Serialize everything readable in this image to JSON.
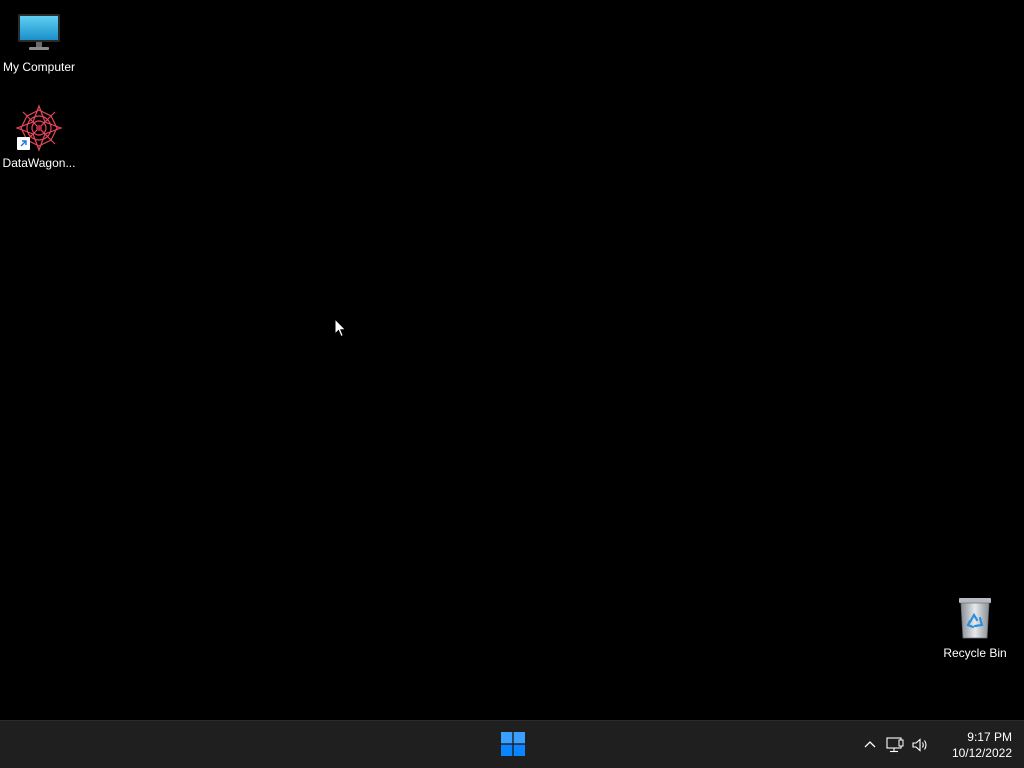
{
  "desktop": {
    "background_color": "#000000",
    "icons": [
      {
        "label": "My Computer",
        "icon": "monitor-icon"
      },
      {
        "label": "DataWagon...",
        "icon": "datawagon-app-icon",
        "shortcut": true
      },
      {
        "label": "Recycle Bin",
        "icon": "recycle-bin-icon"
      }
    ]
  },
  "taskbar": {
    "background_color": "#1f1f1f",
    "start_icon": "windows-start-icon",
    "accent_color": "#0a84ff",
    "tray": {
      "icons": [
        "chevron-up-icon",
        "network-icon",
        "volume-icon"
      ],
      "time": "9:17 PM",
      "date": "10/12/2022"
    }
  }
}
